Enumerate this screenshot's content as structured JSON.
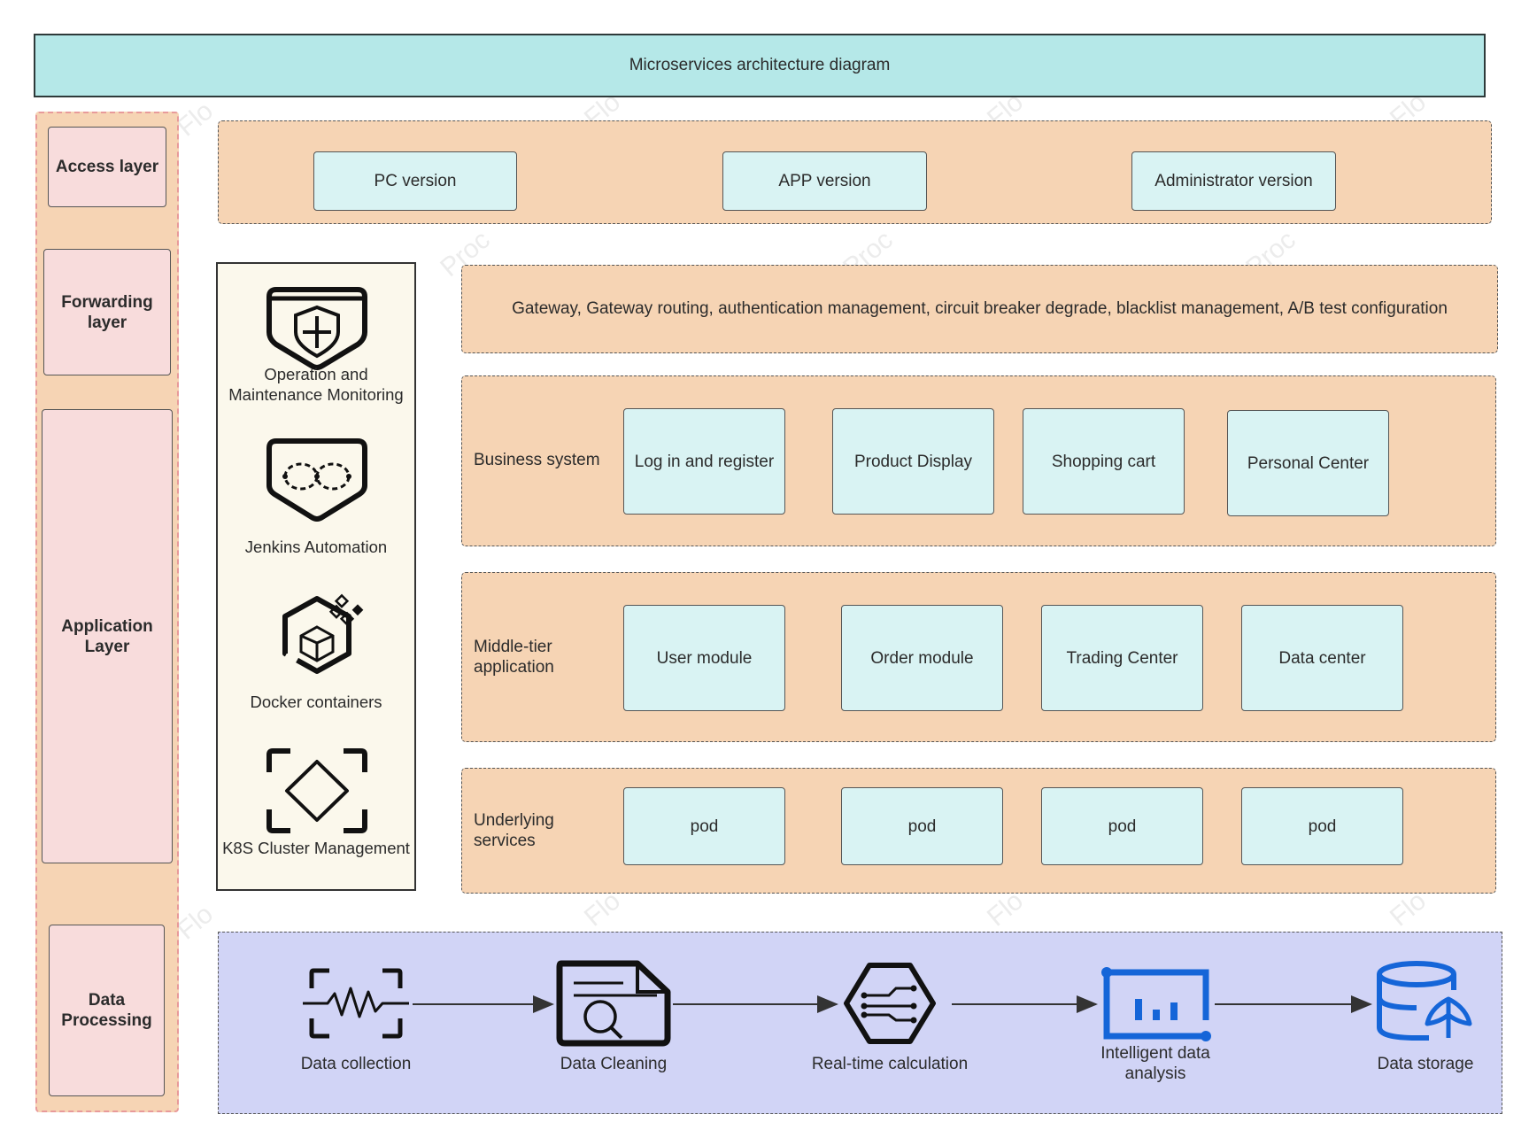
{
  "title": "Microservices architecture diagram",
  "layers": {
    "access": "Access layer",
    "forwarding": "Forwarding layer",
    "application": "Application Layer",
    "data_processing": "Data Processing"
  },
  "access_layer": {
    "items": [
      "PC version",
      "APP version",
      "Administrator version"
    ]
  },
  "forwarding_layer": {
    "text": "Gateway, Gateway routing, authentication management, circuit breaker degrade, blacklist management, A/B test configuration"
  },
  "ops_tools": [
    {
      "label": "Operation and Maintenance Monitoring",
      "icon": "shield-plus-icon"
    },
    {
      "label": "Jenkins Automation",
      "icon": "infinity-pentagon-icon"
    },
    {
      "label": "Docker containers",
      "icon": "container-cube-icon"
    },
    {
      "label": "K8S Cluster Management",
      "icon": "diamond-frame-icon"
    }
  ],
  "business_system": {
    "label": "Business system",
    "items": [
      "Log in and register",
      "Product Display",
      "Shopping cart",
      "Personal Center"
    ]
  },
  "middle_tier": {
    "label": "Middle-tier application",
    "items": [
      "User module",
      "Order module",
      "Trading Center",
      "Data center"
    ]
  },
  "underlying": {
    "label": "Underlying services",
    "items": [
      "pod",
      "pod",
      "pod",
      "pod"
    ]
  },
  "data_flow": {
    "steps": [
      {
        "label": "Data collection",
        "icon": "waveform-frame-icon"
      },
      {
        "label": "Data Cleaning",
        "icon": "document-search-icon"
      },
      {
        "label": "Real-time calculation",
        "icon": "hexagon-circuit-icon"
      },
      {
        "label": "Intelligent data analysis",
        "icon": "bar-chart-icon"
      },
      {
        "label": "Data storage",
        "icon": "database-icon"
      }
    ]
  },
  "colors": {
    "title_bg": "#b5e8e8",
    "band_orange": "#f6d4b4",
    "layer_pink": "#f8dcdc",
    "box_cyan": "#d9f3f3",
    "data_band": "#d1d4f6",
    "ops_bg": "#fbf8ec",
    "blue_icon": "#1565d8"
  }
}
